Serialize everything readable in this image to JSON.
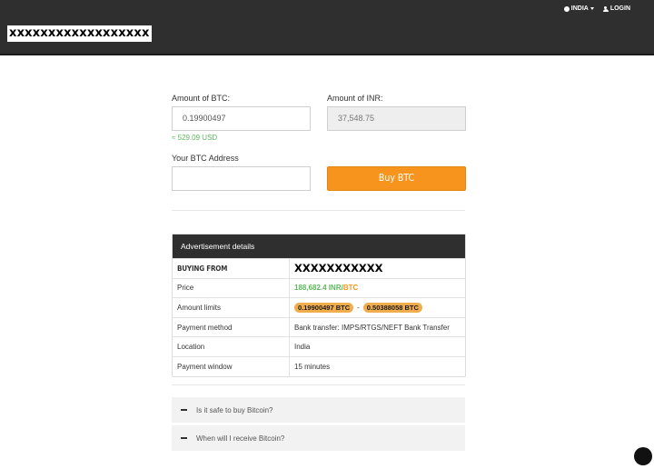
{
  "header": {
    "logo": "xxxxxxxxxxxxxxxxxx",
    "country": "INDIA",
    "login": "LOGIN"
  },
  "form": {
    "btc_label": "Amount of BTC:",
    "btc_value": "0.19900497",
    "inr_label": "Amount of INR:",
    "inr_value": "37,548.75",
    "usd_equiv": "≈ 529.09 USD",
    "address_label": "Your BTC Address",
    "address_value": "",
    "buy_button": "Buy BTC"
  },
  "ad": {
    "title": "Advertisement details",
    "buying_from_label": "BUYING FROM",
    "seller": "XXXXXXXXXXX",
    "price_label": "Price",
    "price_inr": "188,682.4 INR",
    "price_sep": "/",
    "price_btc": "BTC",
    "limits_label": "Amount limits",
    "limit_min": "0.19900497 BTC",
    "limit_dash": "-",
    "limit_max": "0.50388058 BTC",
    "payment_method_label": "Payment method",
    "payment_method": "Bank transfer: IMPS/RTGS/NEFT Bank Transfer",
    "location_label": "Location",
    "location": "India",
    "window_label": "Payment window",
    "window": "15 minutes"
  },
  "faq": [
    {
      "q": "Is it safe to buy Bitcoin?"
    },
    {
      "q": "When will I receive Bitcoin?"
    }
  ],
  "colors": {
    "header_bg": "#2f2f2f",
    "accent_orange": "#f7941d",
    "green": "#5cb85c",
    "pill": "#f0ad4e"
  }
}
